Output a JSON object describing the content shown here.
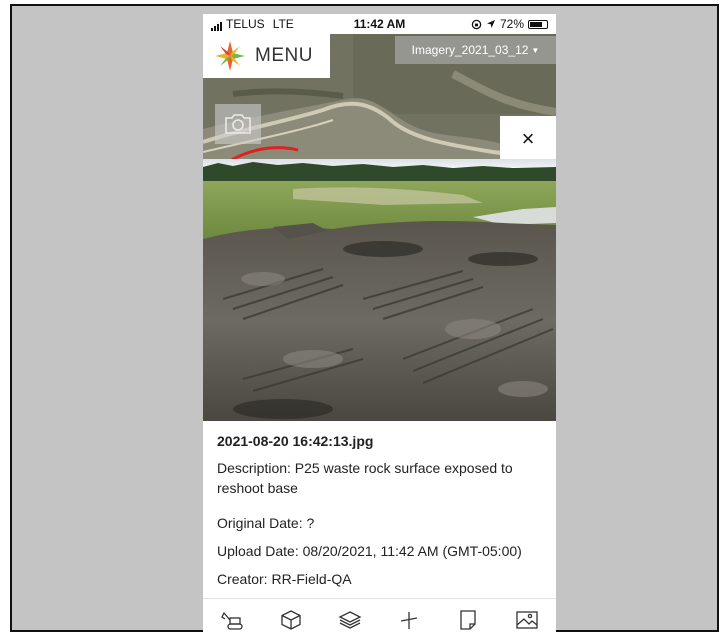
{
  "status_bar": {
    "carrier": "TELUS",
    "network": "LTE",
    "time": "11:42 AM",
    "battery": "72%"
  },
  "map": {
    "menu_label": "MENU",
    "imagery_select": "Imagery_2021_03_12",
    "close_label": "×"
  },
  "photo": {
    "filename": "2021-08-20 16:42:13.jpg",
    "description": "Description: P25 waste rock surface exposed to reshoot base",
    "original_date": "Original Date: ?",
    "upload_date": "Upload Date: 08/20/2021, 11:42 AM (GMT-05:00)",
    "creator": "Creator: RR-Field-QA"
  },
  "toolbar": {
    "icons": [
      "excavator-icon",
      "cube-icon",
      "layers-icon",
      "measure-icon",
      "document-icon",
      "image-icon"
    ]
  }
}
